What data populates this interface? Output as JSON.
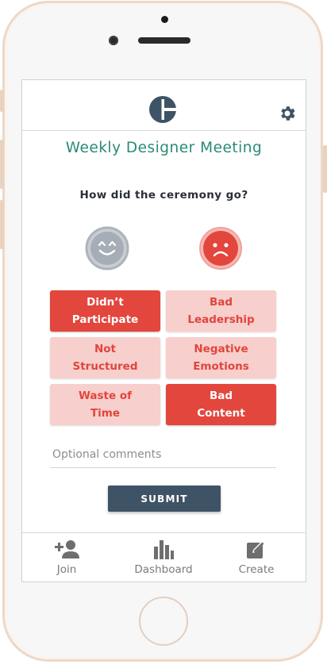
{
  "app": {
    "meeting_title": "Weekly Designer Meeting",
    "question": "How did the ceremony go?"
  },
  "colors": {
    "accent_teal": "#2a8a78",
    "selected_red": "#e2463d",
    "unselected_pink": "#f7cfcc",
    "submit_navy": "#3f5366"
  },
  "faces": [
    {
      "name": "happy-face-icon",
      "state": "unselected"
    },
    {
      "name": "sad-face-icon",
      "state": "selected"
    }
  ],
  "options": [
    {
      "label": "Didn’t\nParticipate",
      "selected": true
    },
    {
      "label": "Bad\nLeadership",
      "selected": false
    },
    {
      "label": "Not\nStructured",
      "selected": false
    },
    {
      "label": "Negative\nEmotions",
      "selected": false
    },
    {
      "label": "Waste of\nTime",
      "selected": false
    },
    {
      "label": "Bad\nContent",
      "selected": true
    }
  ],
  "comments": {
    "value": "",
    "placeholder": "Optional comments"
  },
  "submit_label": "SUBMIT",
  "tabs": [
    {
      "label": "Join",
      "icon": "add-user-icon"
    },
    {
      "label": "Dashboard",
      "icon": "bar-chart-icon"
    },
    {
      "label": "Create",
      "icon": "edit-icon"
    }
  ],
  "header": {
    "logo_icon": "logo-icon",
    "settings_icon": "gear-icon"
  }
}
